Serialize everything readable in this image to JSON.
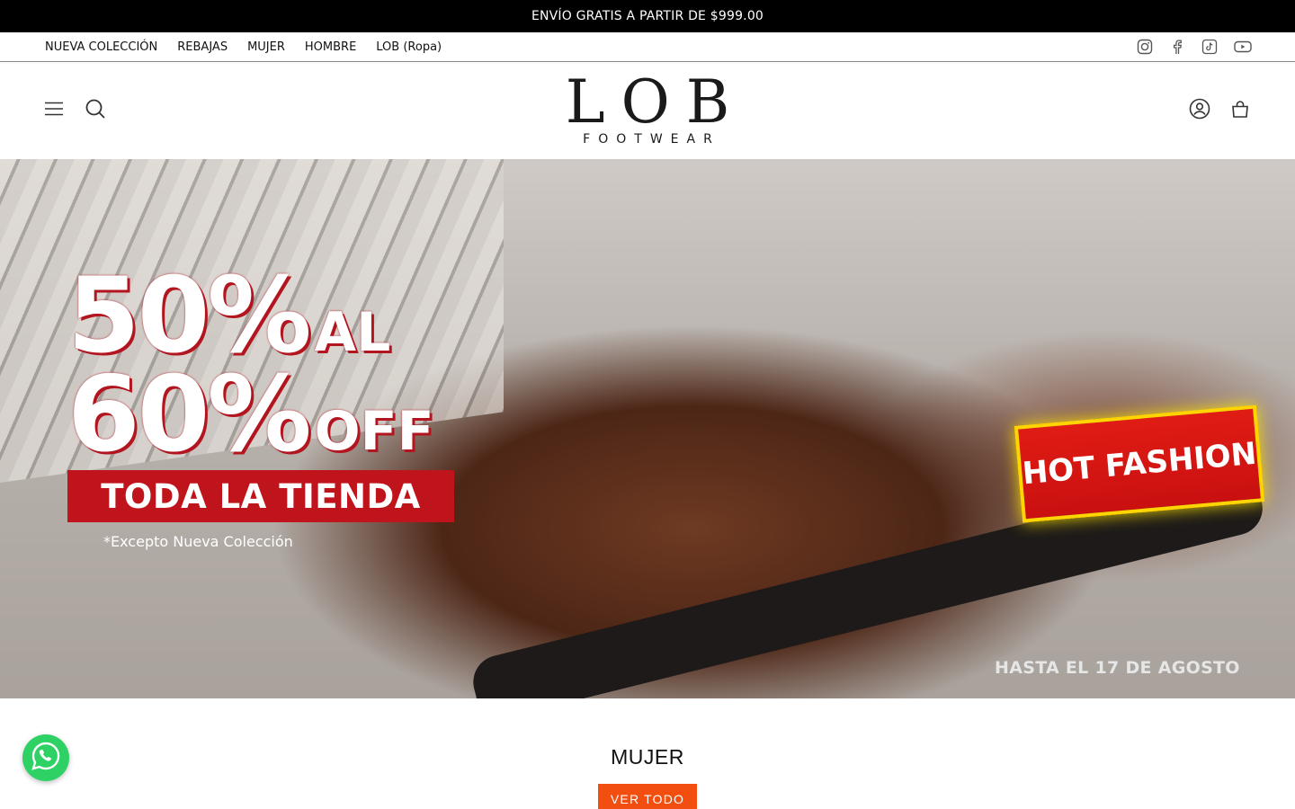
{
  "announcement": "ENVÍO GRATIS A PARTIR DE $999.00",
  "subnav": {
    "links": [
      "NUEVA COLECCIÓN",
      "REBAJAS",
      "MUJER",
      "HOMBRE",
      "LOB (Ropa)"
    ],
    "social": [
      "instagram-icon",
      "facebook-icon",
      "tiktok-icon",
      "youtube-icon"
    ]
  },
  "header": {
    "logo_big": "LOB",
    "logo_small": "FOOTWEAR",
    "left_icons": [
      "menu-icon",
      "search-icon"
    ],
    "right_icons": [
      "account-icon",
      "cart-icon"
    ]
  },
  "hero": {
    "row1_num": "50%",
    "row1_suffix": "AL",
    "row2_num": "60%",
    "row2_suffix": "OFF",
    "band": "TODA LA TIENDA",
    "note": "*Excepto Nueva Colección",
    "badge": "HOT FASHION",
    "date": "HASTA EL 17 DE AGOSTO",
    "colors": {
      "red": "#c0141c",
      "badge_border": "#ffd400"
    }
  },
  "section": {
    "title": "MUJER",
    "cta": "VER TODO",
    "cta_color": "#f24e0f"
  },
  "whatsapp": {
    "icon": "whatsapp-icon",
    "color": "#2ed164"
  }
}
